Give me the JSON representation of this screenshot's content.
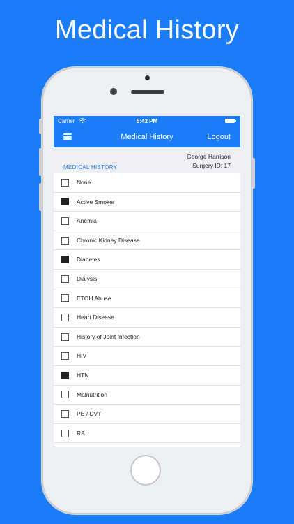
{
  "headline": "Medical History",
  "status_bar": {
    "carrier": "Carrier",
    "time": "5:42 PM"
  },
  "nav": {
    "title": "Medical History",
    "logout_label": "Logout"
  },
  "patient": {
    "name": "George Harrison",
    "surgery_id": "Surgery ID: 17"
  },
  "section_title": "MEDICAL HISTORY",
  "conditions": [
    {
      "label": "None",
      "checked": false
    },
    {
      "label": "Active Smoker",
      "checked": true
    },
    {
      "label": "Anemia",
      "checked": false
    },
    {
      "label": "Chronic Kidney Disease",
      "checked": false
    },
    {
      "label": "Diabetes",
      "checked": true
    },
    {
      "label": "Dialysis",
      "checked": false
    },
    {
      "label": "ETOH Abuse",
      "checked": false
    },
    {
      "label": "Heart Disease",
      "checked": false
    },
    {
      "label": "History of Joint Infection",
      "checked": false
    },
    {
      "label": "HIV",
      "checked": false
    },
    {
      "label": "HTN",
      "checked": true
    },
    {
      "label": "Malnutrition",
      "checked": false
    },
    {
      "label": "PE / DVT",
      "checked": false
    },
    {
      "label": "RA",
      "checked": false
    }
  ],
  "colors": {
    "brand": "#1a7cf6",
    "checked": "#222222",
    "section_bg": "#efeff4"
  }
}
